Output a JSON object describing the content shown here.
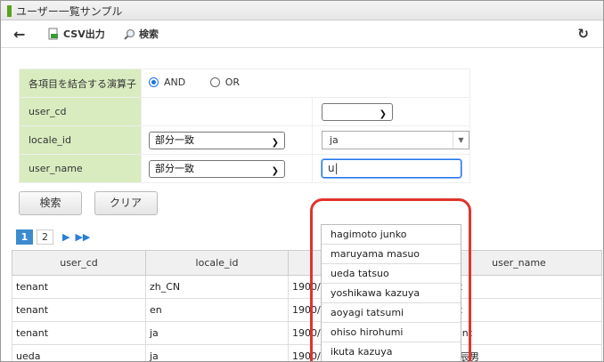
{
  "window": {
    "title": "ユーザー一覧サンプル"
  },
  "toolbar": {
    "back_icon": "←",
    "csv_label": "CSV出力",
    "search_label": "検索",
    "refresh_icon": "↻"
  },
  "form": {
    "operator_label": "各項目を結合する演算子",
    "and_label": "AND",
    "or_label": "OR",
    "selected_operator": "AND",
    "user_cd_label": "user_cd",
    "locale_id_label": "locale_id",
    "user_name_label": "user_name",
    "locale_match": "部分一致",
    "locale_value": "ja",
    "user_name_match": "部分一致",
    "user_name_value": "u",
    "search_button": "検索",
    "clear_button": "クリア"
  },
  "pager": {
    "pages": [
      "1",
      "2"
    ],
    "current": "1"
  },
  "grid": {
    "headers": [
      "user_cd",
      "locale_id",
      "",
      "user_name"
    ],
    "rows": [
      [
        "tenant",
        "zh_CN",
        "1900/0",
        "nant"
      ],
      [
        "tenant",
        "en",
        "1900/0",
        "nant"
      ],
      [
        "tenant",
        "ja",
        "1900/01/01",
        "tenant"
      ],
      [
        "ueda",
        "ja",
        "1900/01/01",
        "上田辰男"
      ]
    ]
  },
  "autocomplete": {
    "items": [
      "hagimoto junko",
      "maruyama masuo",
      "ueda tatsuo",
      "yoshikawa kazuya",
      "aoyagi tatsumi",
      "ohiso hirohumi",
      "ikuta kazuya"
    ]
  },
  "colors": {
    "accent_green": "#58a41d",
    "label_bg": "#d8ecbf",
    "highlight": "#e0342c",
    "pager_active": "#3b8ccf"
  }
}
